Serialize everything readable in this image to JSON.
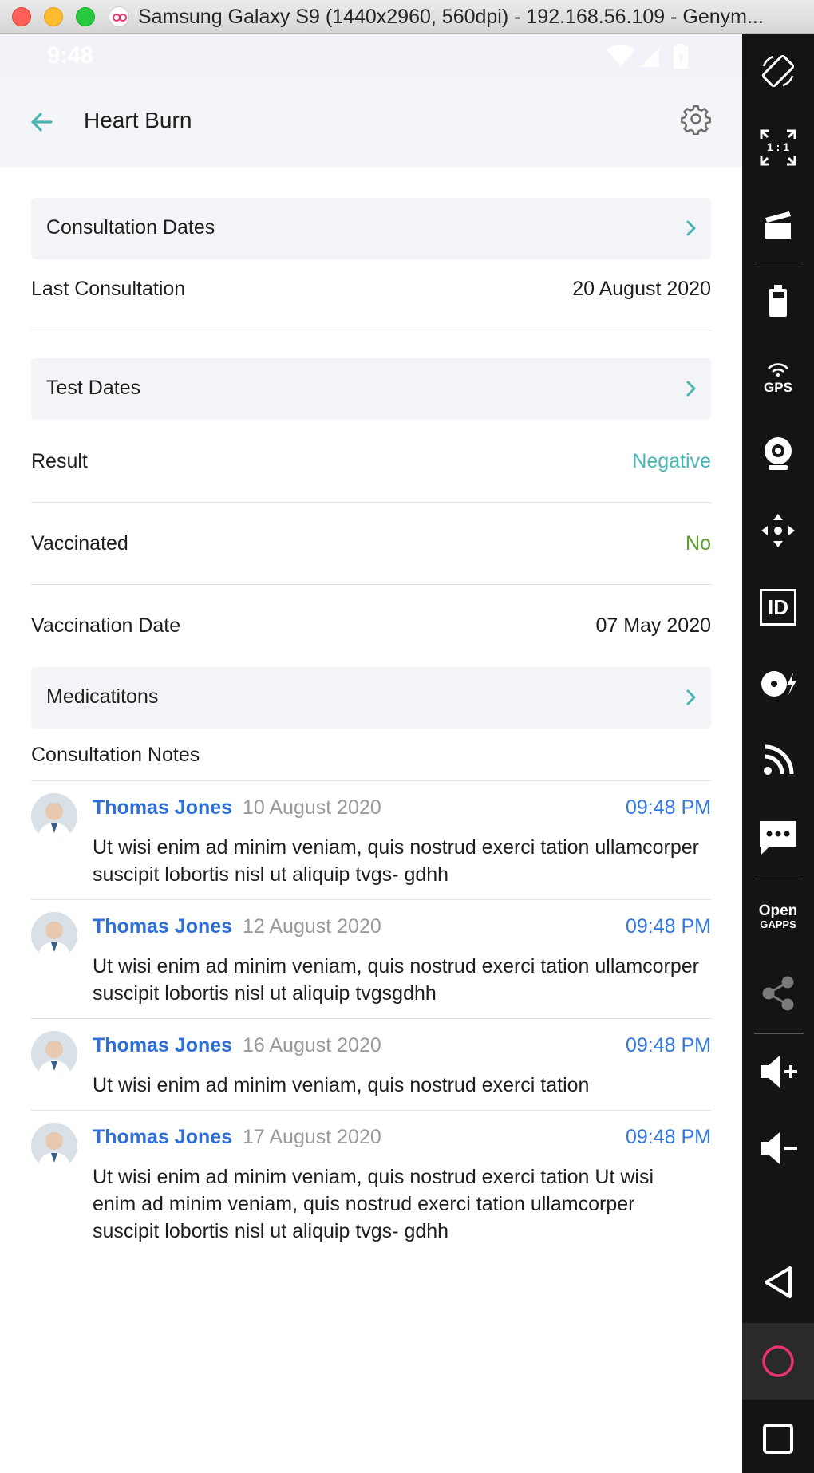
{
  "window": {
    "title": "Samsung Galaxy S9 (1440x2960, 560dpi) - 192.168.56.109 - Genym..."
  },
  "status_bar": {
    "time": "9:48"
  },
  "header": {
    "title": "Heart Burn",
    "back_icon": "arrow-left-icon",
    "settings_icon": "gear-icon"
  },
  "sections": {
    "consultation_dates": "Consultation Dates",
    "last_consultation": {
      "label": "Last Consultation",
      "value": "20 August 2020"
    },
    "test_dates": "Test Dates",
    "result": {
      "label": "Result",
      "value": "Negative",
      "color": "#4ab5b4"
    },
    "vaccinated": {
      "label": "Vaccinated",
      "value": "No",
      "color": "#5aa02c"
    },
    "vaccination_date": {
      "label": "Vaccination Date",
      "value": "07 May 2020"
    },
    "medications": "Medicatitons",
    "consultation_notes": "Consultation Notes"
  },
  "notes": [
    {
      "author": "Thomas Jones",
      "date": "10 August 2020",
      "time": "09:48 PM",
      "text": "Ut wisi enim ad minim veniam, quis nostrud exerci tation ullamcorper suscipit lobortis nisl ut aliquip tvgs- gdhh"
    },
    {
      "author": "Thomas Jones",
      "date": "12 August 2020",
      "time": "09:48 PM",
      "text": "Ut wisi enim ad minim veniam, quis nostrud exerci tation ullamcorper suscipit lobortis nisl ut aliquip tvgsgdhh"
    },
    {
      "author": "Thomas Jones",
      "date": "16 August 2020",
      "time": "09:48 PM",
      "text": "Ut wisi enim ad minim veniam, quis nostrud exerci tation"
    },
    {
      "author": "Thomas Jones",
      "date": "17 August 2020",
      "time": "09:48 PM",
      "text": "Ut wisi enim ad minim veniam, quis nostrud exerci tation Ut wisi enim ad minim veniam, quis nostrud exerci tation ullamcorper suscipit lobortis nisl ut aliquip tvgs- gdhh"
    }
  ],
  "toolbar": {
    "ratio_label": "1 : 1",
    "gps_label": "GPS",
    "id_label": "ID",
    "opengapps_label_top": "Open",
    "opengapps_label_bottom": "GAPPS",
    "icons": [
      "rotate-icon",
      "fullscreen-icon",
      "video-capture-icon",
      "battery-icon",
      "gps-icon",
      "camera-icon",
      "dpad-icon",
      "identifiers-icon",
      "disk-io-icon",
      "cast-icon",
      "sms-icon",
      "open-gapps-icon",
      "share-icon",
      "volume-up-icon",
      "volume-down-icon",
      "back-icon",
      "home-icon",
      "recent-apps-icon"
    ]
  },
  "colors": {
    "accent_teal": "#4ab5b4",
    "link_blue": "#2f6fd8",
    "home_ring": "#e8336e"
  }
}
